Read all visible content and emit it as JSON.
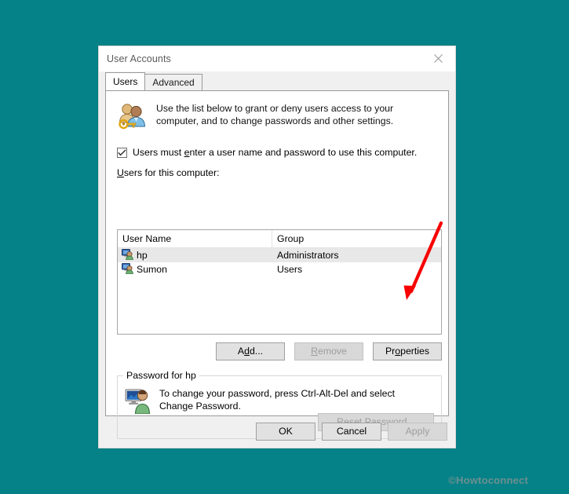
{
  "background_color": "#058287",
  "window": {
    "title": "User Accounts",
    "close_icon": "close-icon"
  },
  "tabs": [
    {
      "label": "Users",
      "active": true
    },
    {
      "label": "Advanced",
      "active": false
    }
  ],
  "users_tab": {
    "intro_icon": "user-accounts-icon",
    "intro_text": "Use the list below to grant or deny users access to your computer, and to change passwords and other settings.",
    "checkbox": {
      "checked": true,
      "label_before": "Users must ",
      "label_accel": "e",
      "label_after": "nter a user name and password to use this computer.",
      "check_glyph": "✓"
    },
    "list_label_accel": "U",
    "list_label_rest": "sers for this computer:",
    "list": {
      "columns": [
        "User Name",
        "Group"
      ],
      "rows": [
        {
          "icon": "user-account-icon",
          "name": "hp",
          "group": "Administrators",
          "selected": true
        },
        {
          "icon": "user-account-icon",
          "name": "Sumon",
          "group": "Users",
          "selected": false
        }
      ]
    },
    "buttons": [
      {
        "name": "add-button",
        "text_before": "A",
        "accel": "d",
        "text_after": "d...",
        "enabled": true
      },
      {
        "name": "remove-button",
        "text_before": "",
        "accel": "R",
        "text_after": "emove",
        "enabled": false
      },
      {
        "name": "properties-button",
        "text_before": "Pr",
        "accel": "o",
        "text_after": "perties",
        "enabled": true
      }
    ],
    "password_group": {
      "legend": "Password for hp",
      "icon": "user-monitor-icon",
      "text": "To change your password, press Ctrl-Alt-Del and select Change Password.",
      "reset_button": {
        "text_before": "Reset ",
        "accel": "P",
        "text_after": "assword...",
        "enabled": false
      }
    }
  },
  "footer_buttons": [
    {
      "name": "ok-button",
      "label": "OK",
      "enabled": true
    },
    {
      "name": "cancel-button",
      "label": "Cancel",
      "enabled": true
    },
    {
      "name": "apply-button",
      "label": "Apply",
      "enabled": false
    }
  ],
  "annotation": {
    "arrow_color": "#f80000",
    "points_to": "properties-button"
  },
  "watermark": {
    "text": "©Howtoconnect",
    "color": "#6e8f90"
  }
}
